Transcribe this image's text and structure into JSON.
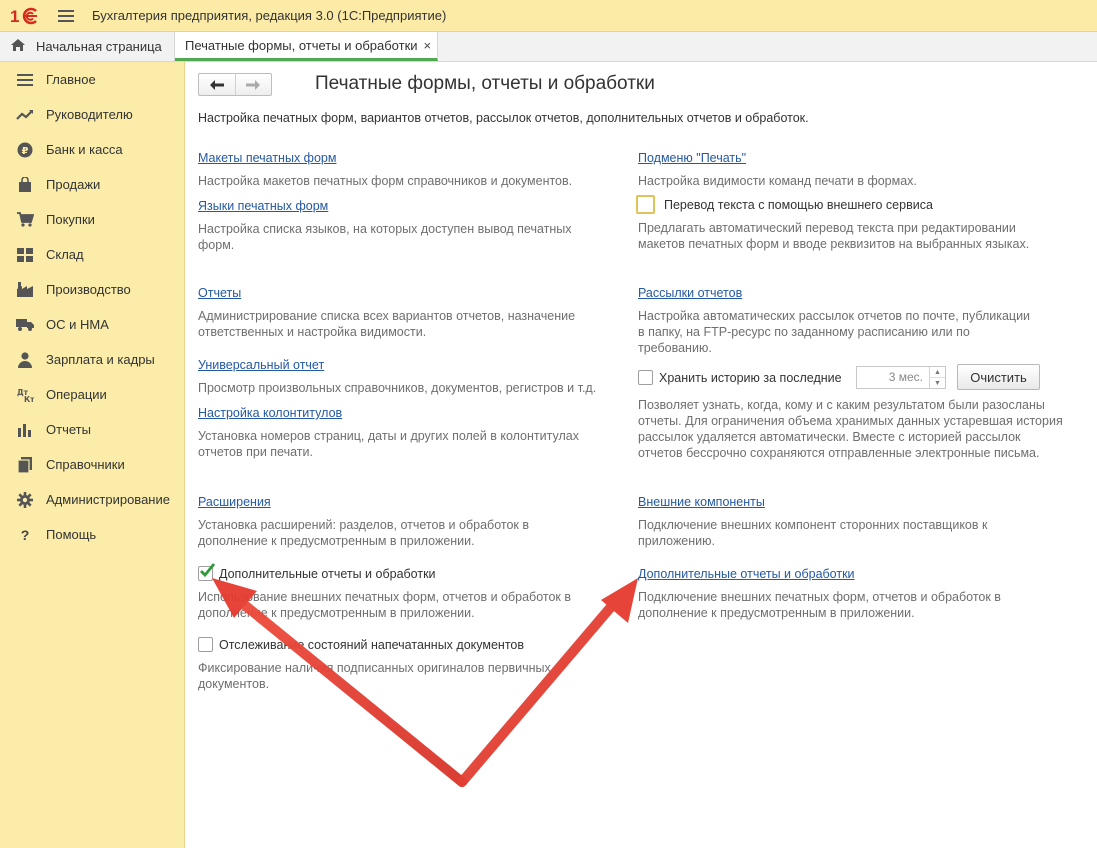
{
  "app": {
    "title": "Бухгалтерия предприятия, редакция 3.0  (1С:Предприятие)",
    "logo_text": "1С"
  },
  "tabs": {
    "home_label": "Начальная страница",
    "active_label": "Печатные формы, отчеты и обработки",
    "close_glyph": "×"
  },
  "sidebar": {
    "items": [
      {
        "label": "Главное",
        "icon": "menu-lines-icon"
      },
      {
        "label": "Руководителю",
        "icon": "trend-icon"
      },
      {
        "label": "Банк и касса",
        "icon": "ruble-coin-icon"
      },
      {
        "label": "Продажи",
        "icon": "shopping-bag-icon"
      },
      {
        "label": "Покупки",
        "icon": "cart-icon"
      },
      {
        "label": "Склад",
        "icon": "warehouse-icon"
      },
      {
        "label": "Производство",
        "icon": "factory-icon"
      },
      {
        "label": "ОС и НМА",
        "icon": "truck-icon"
      },
      {
        "label": "Зарплата и кадры",
        "icon": "person-icon"
      },
      {
        "label": "Операции",
        "icon": "debit-credit-icon"
      },
      {
        "label": "Отчеты",
        "icon": "bar-chart-icon"
      },
      {
        "label": "Справочники",
        "icon": "books-icon"
      },
      {
        "label": "Администрирование",
        "icon": "gear-icon"
      },
      {
        "label": "Помощь",
        "icon": "question-icon"
      }
    ]
  },
  "main": {
    "title": "Печатные формы, отчеты и обработки",
    "description": "Настройка печатных форм, вариантов отчетов, рассылок отчетов, дополнительных отчетов и обработок.",
    "left": {
      "makety_link": "Макеты печатных форм",
      "makety_desc": "Настройка макетов печатных форм справочников и документов.",
      "yazyki_link": "Языки печатных форм",
      "yazyki_desc": "Настройка списка языков, на которых доступен вывод печатных форм.",
      "otchety_link": "Отчеты",
      "otchety_desc": "Администрирование списка всех вариантов отчетов, назначение ответственных и настройка видимости.",
      "universal_link": "Универсальный отчет",
      "universal_desc": "Просмотр произвольных справочников, документов, регистров и т.д.",
      "kolontituly_link": "Настройка колонтитулов",
      "kolontituly_desc": "Установка номеров страниц, даты и других полей в колонтитулах отчетов при печати.",
      "rasshireniya_link": "Расширения",
      "rasshireniya_desc": "Установка расширений: разделов, отчетов и обработок в дополнение к предусмотренным в приложении.",
      "dop_checkbox_label": "Дополнительные отчеты и обработки",
      "dop_checkbox_checked": true,
      "dop_desc": "Использование внешних печатных форм, отчетов и обработок в дополнение к предусмотренным в приложении.",
      "tracking_checkbox_label": "Отслеживание состояний напечатанных документов",
      "tracking_checkbox_checked": false,
      "tracking_desc": "Фиксирование наличия подписанных оригиналов первичных документов."
    },
    "right": {
      "podmenu_link": "Подменю \"Печать\"",
      "podmenu_desc": "Настройка видимости команд печати в формах.",
      "perevod_checkbox_label": "Перевод текста с помощью внешнего сервиса",
      "perevod_checkbox_checked": false,
      "perevod_desc": "Предлагать автоматический перевод текста при редактировании макетов печатных форм и вводе реквизитов на выбранных языках.",
      "rassylki_link": "Рассылки отчетов",
      "rassylki_desc": "Настройка автоматических рассылок отчетов по почте, публикации в папку, на FTP-ресурс по заданному расписанию или по требованию.",
      "history_checkbox_label": "Хранить историю за последние",
      "history_checkbox_checked": false,
      "history_value": "3 мес.",
      "clear_button": "Очистить",
      "history_desc": "Позволяет узнать, когда, кому и с каким результатом были разосланы отчеты. Для ограничения объема хранимых данных устаревшая история рассылок удаляется автоматически. Вместе с историей рассылок отчетов бессрочно сохраняются отправленные электронные письма.",
      "vneshnie_link": "Внешние компоненты",
      "vneshnie_desc": "Подключение внешних компонент сторонних поставщиков к приложению.",
      "dop_link": "Дополнительные отчеты и обработки",
      "dop_desc": "Подключение внешних печатных форм, отчетов и обработок в дополнение к предусмотренным в приложении."
    }
  },
  "colors": {
    "sidebar_bg": "#fbeda9",
    "titlebar_bg": "#fbeba6",
    "link": "#2459a3",
    "active_tab_underline": "#52a852",
    "annotation_arrow": "#e53a2f",
    "checkbox_check": "#2f9a3a"
  }
}
